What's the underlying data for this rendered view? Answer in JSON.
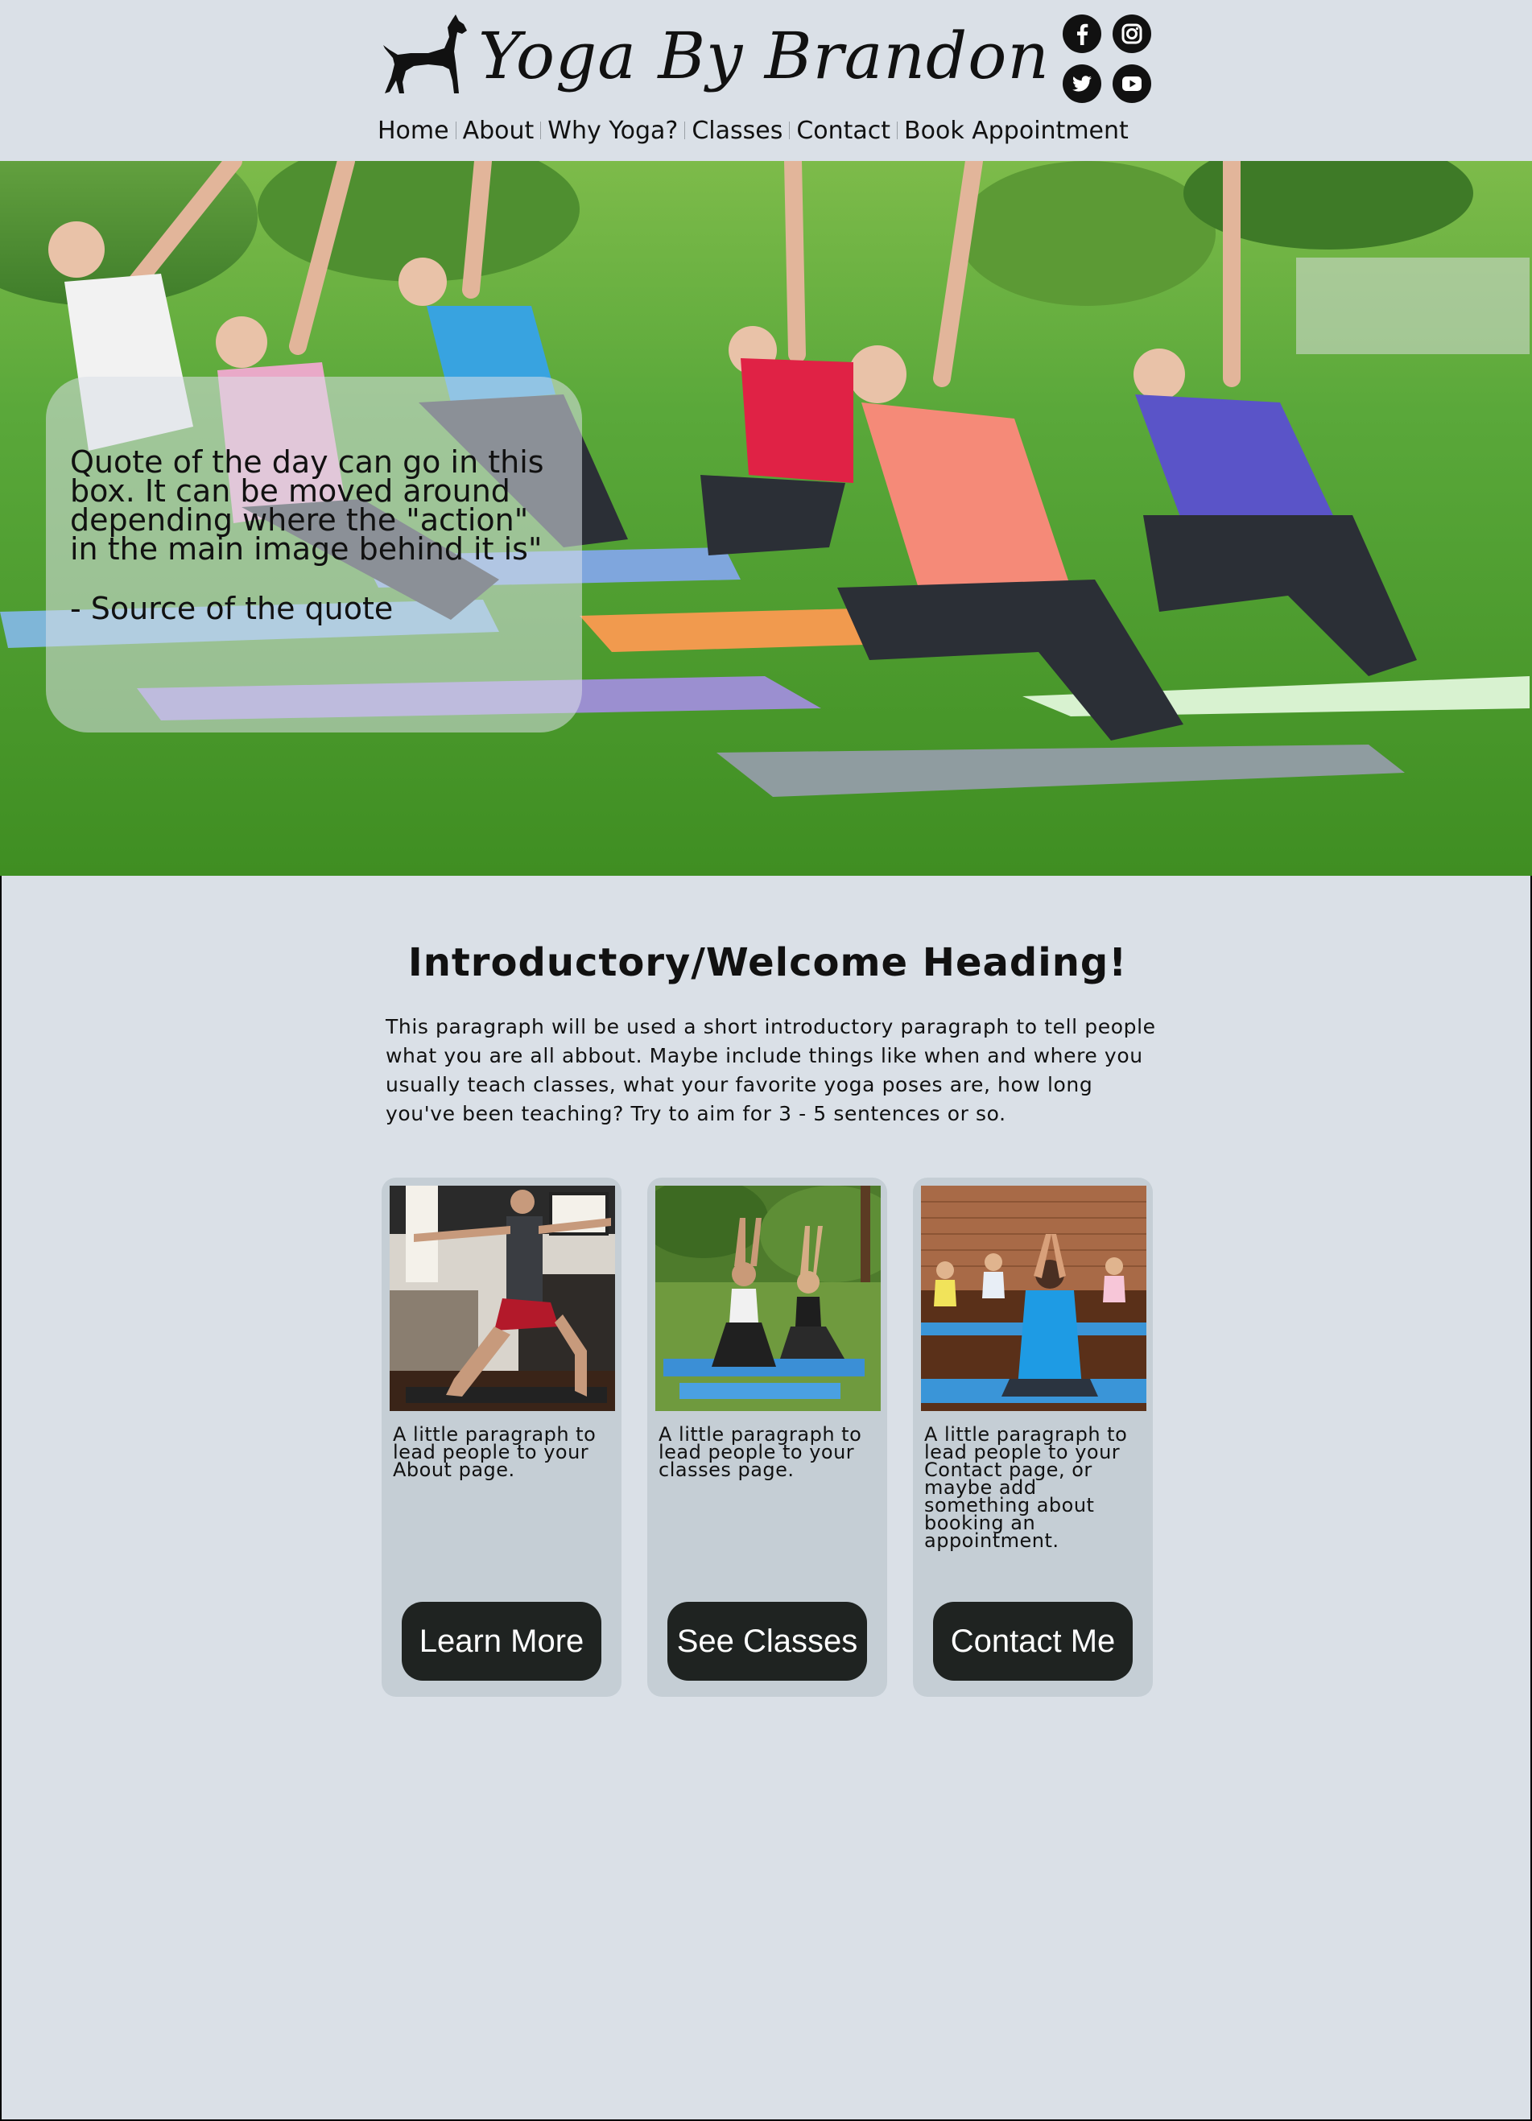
{
  "header": {
    "logo_text": "Yoga By Brandon",
    "social": [
      {
        "icon": "facebook-icon"
      },
      {
        "icon": "instagram-icon"
      },
      {
        "icon": "twitter-icon"
      },
      {
        "icon": "youtube-icon"
      }
    ],
    "nav": [
      {
        "label": "Home"
      },
      {
        "label": "About"
      },
      {
        "label": "Why Yoga?"
      },
      {
        "label": "Classes"
      },
      {
        "label": "Contact"
      },
      {
        "label": "Book Appointment"
      }
    ]
  },
  "hero": {
    "quote": "Quote of the day can go in this box. It can be moved around depending where the \"action\" in the main image behind it is\"",
    "source": "- Source of the quote"
  },
  "intro": {
    "heading": "Introductory/Welcome Heading!",
    "paragraph": "This paragraph will be used a short introductory paragraph to tell people what you are all abbout. Maybe include things like when and where you usually teach classes, what your favorite yoga poses are, how long you've been teaching? Try to aim for 3 - 5 sentences or so."
  },
  "cards": [
    {
      "text": "A little paragraph to lead people to your About page.",
      "button": "Learn More"
    },
    {
      "text": "A little paragraph to lead people to your classes page.",
      "button": "See Classes"
    },
    {
      "text": "A little paragraph to lead people to your Contact page, or maybe add something about booking an appointment.",
      "button": "Contact Me"
    }
  ],
  "colors": {
    "page_background": "#dae0e7",
    "card_background": "#c5ced5",
    "button_background": "#1f2321",
    "button_text": "#ffffff"
  }
}
